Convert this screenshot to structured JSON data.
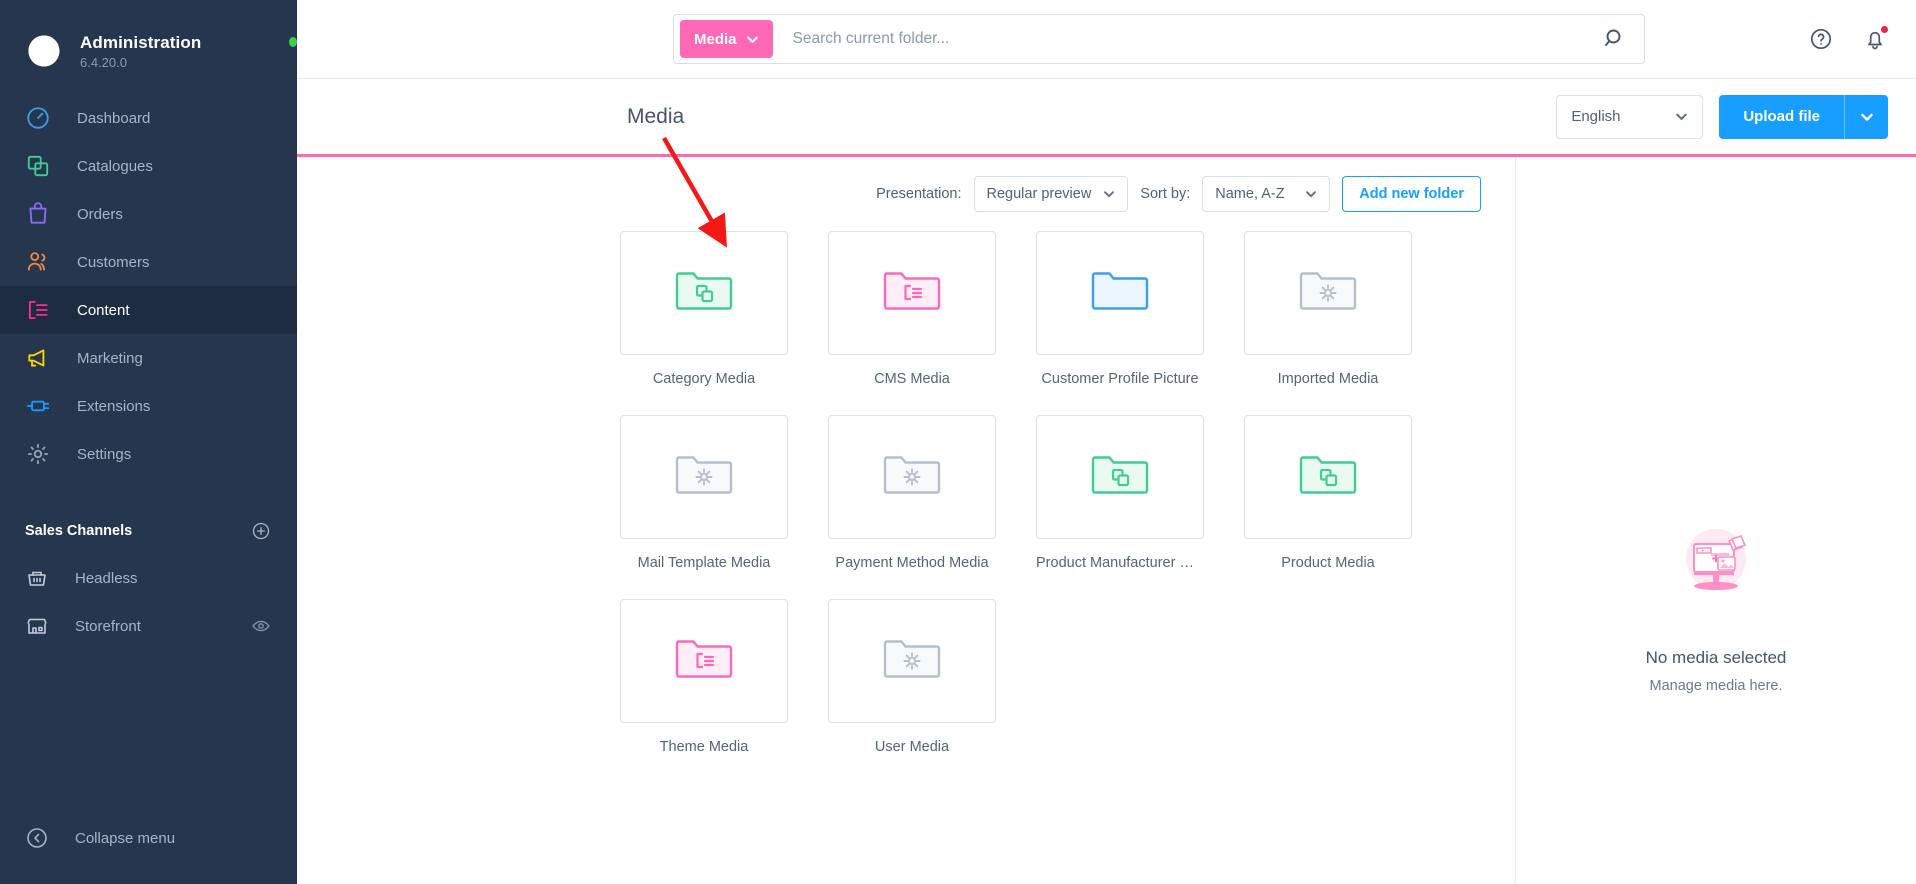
{
  "sidebar": {
    "brand": {
      "title": "Administration",
      "version": "6.4.20.0",
      "status_color": "#37d046"
    },
    "items": [
      {
        "label": "Dashboard",
        "icon": "gauge-icon",
        "color": "#3f9ce8",
        "active": false
      },
      {
        "label": "Catalogues",
        "icon": "catalogue-icon",
        "color": "#3ecf8e",
        "active": false
      },
      {
        "label": "Orders",
        "icon": "bag-icon",
        "color": "#8d6cf0",
        "active": false
      },
      {
        "label": "Customers",
        "icon": "users-icon",
        "color": "#f2873f",
        "active": false
      },
      {
        "label": "Content",
        "icon": "content-icon",
        "color": "#ff2d8b",
        "active": true
      },
      {
        "label": "Marketing",
        "icon": "megaphone-icon",
        "color": "#ffd600",
        "active": false
      },
      {
        "label": "Extensions",
        "icon": "plug-icon",
        "color": "#199aff",
        "active": false
      },
      {
        "label": "Settings",
        "icon": "gear-icon",
        "color": "#97a4b8",
        "active": false
      }
    ],
    "sales_channels": {
      "title": "Sales Channels",
      "add_icon": "plus-circle-icon",
      "items": [
        {
          "label": "Headless",
          "icon": "basket-icon",
          "has_eye": false
        },
        {
          "label": "Storefront",
          "icon": "shop-icon",
          "has_eye": true
        }
      ]
    },
    "collapse": {
      "label": "Collapse menu",
      "icon": "chevron-left-circle-icon"
    }
  },
  "topbar": {
    "scope_label": "Media",
    "scope_chevron": "chevron-down-icon",
    "search_placeholder": "Search current folder...",
    "search_value": "",
    "search_icon": "search-icon",
    "help_icon": "question-circle-icon",
    "bell_icon": "bell-icon",
    "has_notification": true,
    "accent_color": "#ff68b4"
  },
  "pagehead": {
    "title": "Media",
    "language": {
      "value": "English",
      "chevron": "chevron-down-icon"
    },
    "upload": {
      "label": "Upload file",
      "chevron": "chevron-down-icon",
      "color": "#189eff"
    }
  },
  "media_toolbar": {
    "presentation_label": "Presentation:",
    "presentation_value": "Regular preview",
    "sort_label": "Sort by:",
    "sort_value": "Name, A-Z",
    "add_folder_label": "Add new folder"
  },
  "folders": [
    {
      "name": "Category Media",
      "icon": "folder-catalogue-icon",
      "color": "#3ecf8e",
      "fill": "#eafaf2"
    },
    {
      "name": "CMS Media",
      "icon": "folder-content-icon",
      "color": "#ff68b4",
      "fill": "#ffeef6"
    },
    {
      "name": "Customer Profile Picture",
      "icon": "folder-plain-icon",
      "color": "#3f9ce8",
      "fill": "#eaf5fd"
    },
    {
      "name": "Imported Media",
      "icon": "folder-gear-icon",
      "color": "#b4bfcd",
      "fill": "#f7f9fb"
    },
    {
      "name": "Mail Template Media",
      "icon": "folder-gear-icon",
      "color": "#b4bfcd",
      "fill": "#f7f9fb"
    },
    {
      "name": "Payment Method Media",
      "icon": "folder-gear-icon",
      "color": "#b4bfcd",
      "fill": "#f7f9fb"
    },
    {
      "name": "Product Manufacturer Me…",
      "icon": "folder-catalogue-icon",
      "color": "#3ecf8e",
      "fill": "#eafaf2"
    },
    {
      "name": "Product Media",
      "icon": "folder-catalogue-icon",
      "color": "#3ecf8e",
      "fill": "#eafaf2"
    },
    {
      "name": "Theme Media",
      "icon": "folder-content-icon",
      "color": "#ff68b4",
      "fill": "#ffeef6"
    },
    {
      "name": "User Media",
      "icon": "folder-gear-icon",
      "color": "#b4bfcd",
      "fill": "#f7f9fb"
    }
  ],
  "side_pane": {
    "illustration": "media-placeholder-illustration",
    "title": "No media selected",
    "subtitle": "Manage media here."
  },
  "annotation": {
    "type": "arrow",
    "color": "#f51818"
  }
}
